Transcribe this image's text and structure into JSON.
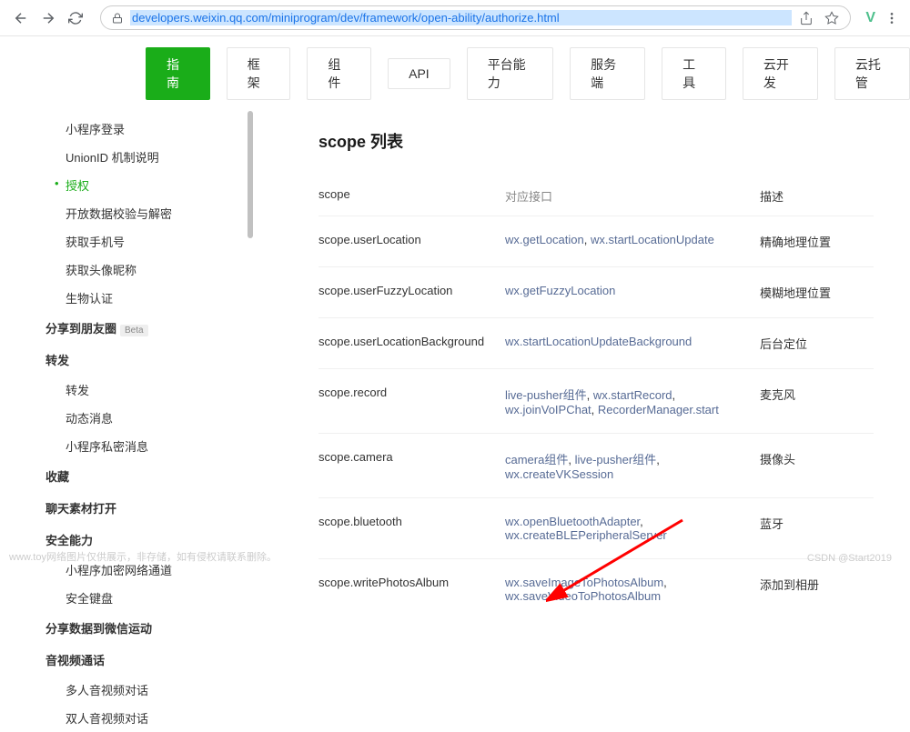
{
  "browser": {
    "url": "developers.weixin.qq.com/miniprogram/dev/framework/open-ability/authorize.html"
  },
  "tabs": [
    {
      "label": "指南",
      "active": true
    },
    {
      "label": "框架",
      "active": false
    },
    {
      "label": "组件",
      "active": false
    },
    {
      "label": "API",
      "active": false
    },
    {
      "label": "平台能力",
      "active": false
    },
    {
      "label": "服务端",
      "active": false
    },
    {
      "label": "工具",
      "active": false
    },
    {
      "label": "云开发",
      "active": false
    },
    {
      "label": "云托管",
      "active": false
    }
  ],
  "sidebar": {
    "groups": [
      {
        "items": [
          {
            "label": "小程序登录",
            "type": "item"
          },
          {
            "label": "UnionID 机制说明",
            "type": "item"
          },
          {
            "label": "授权",
            "type": "item",
            "active": true
          },
          {
            "label": "开放数据校验与解密",
            "type": "item"
          },
          {
            "label": "获取手机号",
            "type": "item"
          },
          {
            "label": "获取头像昵称",
            "type": "item"
          },
          {
            "label": "生物认证",
            "type": "item"
          }
        ]
      },
      {
        "label": "分享到朋友圈",
        "badge": "Beta",
        "items": []
      },
      {
        "label": "转发",
        "items": [
          {
            "label": "转发",
            "type": "item"
          },
          {
            "label": "动态消息",
            "type": "item"
          },
          {
            "label": "小程序私密消息",
            "type": "item"
          }
        ]
      },
      {
        "label": "收藏",
        "items": []
      },
      {
        "label": "聊天素材打开",
        "items": []
      },
      {
        "label": "安全能力",
        "items": [
          {
            "label": "小程序加密网络通道",
            "type": "item"
          },
          {
            "label": "安全键盘",
            "type": "item"
          }
        ]
      },
      {
        "label": "分享数据到微信运动",
        "items": []
      },
      {
        "label": "音视频通话",
        "items": [
          {
            "label": "多人音视频对话",
            "type": "item"
          },
          {
            "label": "双人音视频对话",
            "type": "item"
          }
        ]
      }
    ]
  },
  "content": {
    "title": "scope 列表",
    "table": {
      "headers": {
        "scope": "scope",
        "api": "对应接口",
        "desc": "描述"
      },
      "rows": [
        {
          "scope": "scope.userLocation",
          "apis": [
            {
              "t": "wx.getLocation",
              "l": true
            },
            {
              "t": ", ",
              "l": false
            },
            {
              "t": "wx.startLocationUpdate",
              "l": true
            }
          ],
          "desc": "精确地理位置"
        },
        {
          "scope": "scope.userFuzzyLocation",
          "apis": [
            {
              "t": "wx.getFuzzyLocation",
              "l": true
            }
          ],
          "desc": "模糊地理位置"
        },
        {
          "scope": "scope.userLocationBackground",
          "apis": [
            {
              "t": "wx.startLocationUpdateBackground",
              "l": true
            }
          ],
          "desc": "后台定位"
        },
        {
          "scope": "scope.record",
          "apis": [
            {
              "t": "live-pusher组件",
              "l": true
            },
            {
              "t": ", ",
              "l": false
            },
            {
              "t": "wx.startRecord",
              "l": true
            },
            {
              "t": ", ",
              "l": false
            },
            {
              "t": "wx.joinVoIPChat",
              "l": true
            },
            {
              "t": ", ",
              "l": false
            },
            {
              "t": "RecorderManager.start",
              "l": true
            }
          ],
          "desc": "麦克风"
        },
        {
          "scope": "scope.camera",
          "apis": [
            {
              "t": "camera组件",
              "l": true
            },
            {
              "t": ", ",
              "l": false
            },
            {
              "t": "live-pusher组件",
              "l": true
            },
            {
              "t": ", ",
              "l": false
            },
            {
              "t": "wx.createVKSession",
              "l": true
            }
          ],
          "desc": "摄像头"
        },
        {
          "scope": "scope.bluetooth",
          "apis": [
            {
              "t": "wx.openBluetoothAdapter",
              "l": true
            },
            {
              "t": ", ",
              "l": false
            },
            {
              "t": "wx.createBLEPeripheralServer",
              "l": true
            }
          ],
          "desc": "蓝牙"
        },
        {
          "scope": "scope.writePhotosAlbum",
          "apis": [
            {
              "t": "wx.saveImageToPhotosAlbum",
              "l": true
            },
            {
              "t": ", ",
              "l": false
            },
            {
              "t": "wx.saveVideoToPhotosAlbum",
              "l": true
            }
          ],
          "desc": "添加到相册"
        }
      ]
    }
  },
  "watermark": {
    "left": "网络图片仅供展示，非存储，如有侵权请联系删除。",
    "left_prefix": "www.toy",
    "right": "CSDN @Start2019"
  }
}
